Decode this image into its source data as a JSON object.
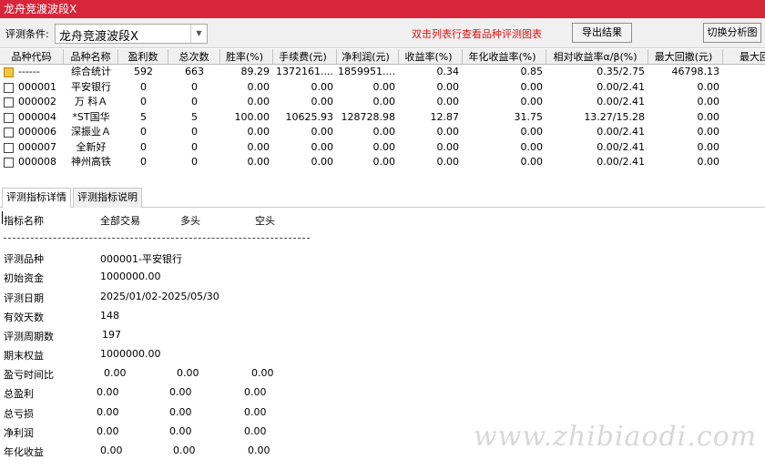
{
  "window": {
    "title": "龙舟竞渡波段X"
  },
  "toolbar": {
    "label": "评测条件:",
    "combo_value": "龙舟竞渡波段X",
    "hint": "双击列表行查看品种评测图表",
    "export_label": "导出结果",
    "switch_label": "切换分析图"
  },
  "table": {
    "headers": [
      "品种代码",
      "品种名称",
      "盈利数",
      "总次数",
      "胜率(%)",
      "手续费(元)",
      "净利润(元)",
      "收益率(%)",
      "年化收益率(%)",
      "相对收益率α/β(%)",
      "最大回撤(元)",
      "最大回"
    ],
    "rows": [
      [
        "------",
        "综合统计",
        "592",
        "663",
        "89.29",
        "1372161....",
        "1859951....",
        "0.34",
        "0.85",
        "0.35/2.75",
        "46798.13",
        ""
      ],
      [
        "000001",
        "平安银行",
        "0",
        "0",
        "0.00",
        "0.00",
        "0.00",
        "0.00",
        "0.00",
        "0.00/2.41",
        "0.00",
        ""
      ],
      [
        "000002",
        "万 科Ａ",
        "0",
        "0",
        "0.00",
        "0.00",
        "0.00",
        "0.00",
        "0.00",
        "0.00/2.41",
        "0.00",
        ""
      ],
      [
        "000004",
        "*ST国华",
        "5",
        "5",
        "100.00",
        "10625.93",
        "128728.98",
        "12.87",
        "31.75",
        "13.27/15.28",
        "0.00",
        ""
      ],
      [
        "000006",
        "深振业Ａ",
        "0",
        "0",
        "0.00",
        "0.00",
        "0.00",
        "0.00",
        "0.00",
        "0.00/2.41",
        "0.00",
        ""
      ],
      [
        "000007",
        "全新好",
        "0",
        "0",
        "0.00",
        "0.00",
        "0.00",
        "0.00",
        "0.00",
        "0.00/2.41",
        "0.00",
        ""
      ],
      [
        "000008",
        "神州高铁",
        "0",
        "0",
        "0.00",
        "0.00",
        "0.00",
        "0.00",
        "0.00",
        "0.00/2.41",
        "0.00",
        ""
      ]
    ]
  },
  "tabs": [
    "评测指标详情",
    "评测指标说明"
  ],
  "detail": {
    "col_headers": [
      "指标名称",
      "全部交易",
      "多头",
      "空头"
    ],
    "dash_line": "--------------------------------------------------------------------------------",
    "items": [
      {
        "label": "评测品种",
        "value": "000001-平安银行"
      },
      {
        "label": "初始资金",
        "value": "1000000.00"
      },
      {
        "label": "评测日期",
        "value": "2025/01/02-2025/05/30"
      },
      {
        "label": "有效天数",
        "value": "148"
      },
      {
        "label": "评测周期数",
        "value": "197"
      },
      {
        "label": "期末权益",
        "value": "1000000.00"
      }
    ],
    "stats": [
      {
        "label": "盈亏时间比",
        "all": "0.00",
        "long": "0.00",
        "short": "0.00"
      },
      {
        "label": "总盈利",
        "all": "0.00",
        "long": "0.00",
        "short": "0.00"
      },
      {
        "label": "总亏损",
        "all": "0.00",
        "long": "0.00",
        "short": "0.00"
      },
      {
        "label": "净利润",
        "all": "0.00",
        "long": "0.00",
        "short": "0.00"
      },
      {
        "label": "年化收益",
        "all": "0.00",
        "long": "0.00",
        "short": "0.00"
      }
    ]
  },
  "watermark": "www.zhibiaodi.com"
}
